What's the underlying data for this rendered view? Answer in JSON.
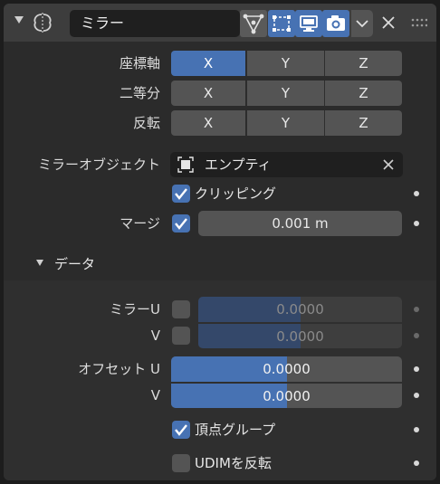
{
  "header": {
    "modifier_name": "ミラー",
    "icons": [
      "collapse-triangle",
      "mirror-modifier-icon",
      "edit-mode-icon",
      "cage-icon",
      "realtime-display-icon",
      "render-icon",
      "dropdown-chevron-icon",
      "delete-icon",
      "drag-grip-icon"
    ]
  },
  "axis": {
    "label": "座標軸",
    "x": "X",
    "y": "Y",
    "z": "Z",
    "active": [
      "X"
    ]
  },
  "bisect": {
    "label": "二等分",
    "x": "X",
    "y": "Y",
    "z": "Z",
    "active": []
  },
  "flip": {
    "label": "反転",
    "x": "X",
    "y": "Y",
    "z": "Z",
    "active": []
  },
  "mirror_object": {
    "label": "ミラーオブジェクト",
    "value": "エンプティ"
  },
  "clipping": {
    "label": "クリッピング",
    "checked": true
  },
  "merge": {
    "label": "マージ",
    "checked": true,
    "value": "0.001 m"
  },
  "data_section": {
    "title": "データ",
    "mirror_u": {
      "label": "ミラーU",
      "checked": false,
      "value": "0.0000",
      "fill": 0.5
    },
    "mirror_v": {
      "label": "V",
      "checked": false,
      "value": "0.0000",
      "fill": 0.5
    },
    "offset_u": {
      "label": "オフセット U",
      "value": "0.0000",
      "fill": 0.5
    },
    "offset_v": {
      "label": "V",
      "value": "0.0000",
      "fill": 0.5
    },
    "vertex_groups": {
      "label": "頂点グループ",
      "checked": true
    },
    "flip_udim": {
      "label": "UDIMを反転",
      "checked": false
    }
  },
  "colors": {
    "accent": "#4772b3",
    "panel": "#2b2b2b",
    "header": "#3d3d3d",
    "widget": "#545454"
  }
}
